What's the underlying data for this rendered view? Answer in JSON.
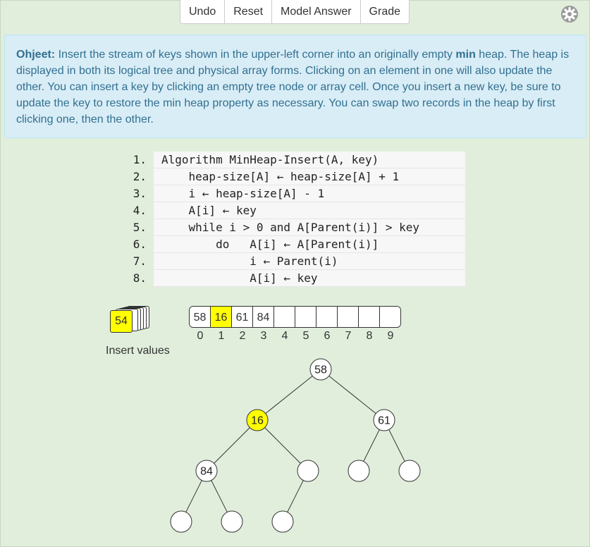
{
  "toolbar": {
    "undo": "Undo",
    "reset": "Reset",
    "model_answer": "Model Answer",
    "grade": "Grade"
  },
  "instructions": {
    "label": "Ohjeet:",
    "part1": " Insert the stream of keys shown in the upper-left corner into an originally empty ",
    "bold": "min",
    "part2": " heap. The heap is displayed in both its logical tree and physical array forms. Clicking on an element in one will also update the other. You can insert a key by clicking an empty tree node or array cell. Once you insert a new key, be sure to update the key to restore the min heap property as necessary. You can swap two records in the heap by first clicking one, then the other."
  },
  "pseudocode": [
    {
      "num": "1.",
      "text": "Algorithm MinHeap-Insert(A, key)"
    },
    {
      "num": "2.",
      "text": "    heap-size[A] ← heap-size[A] + 1"
    },
    {
      "num": "3.",
      "text": "    i ← heap-size[A] - 1"
    },
    {
      "num": "4.",
      "text": "    A[i] ← key"
    },
    {
      "num": "5.",
      "text": "    while i > 0 and A[Parent(i)] > key"
    },
    {
      "num": "6.",
      "text": "        do   A[i] ← A[Parent(i)]"
    },
    {
      "num": "7.",
      "text": "             i ← Parent(i)"
    },
    {
      "num": "8.",
      "text": "             A[i] ← key"
    }
  ],
  "insert": {
    "current": "54",
    "label": "Insert values"
  },
  "array": {
    "cells": [
      "58",
      "16",
      "61",
      "84",
      "",
      "",
      "",
      "",
      "",
      ""
    ],
    "indices": [
      "0",
      "1",
      "2",
      "3",
      "4",
      "5",
      "6",
      "7",
      "8",
      "9"
    ],
    "highlight_index": 1
  },
  "tree": {
    "nodes": [
      "58",
      "16",
      "61",
      "84",
      "",
      "",
      "",
      "",
      "",
      ""
    ],
    "highlight_index": 1
  },
  "colors": {
    "highlight": "#ffff00",
    "background": "#e1eedc",
    "info_bg": "#d9edf7",
    "info_text": "#31708f"
  }
}
